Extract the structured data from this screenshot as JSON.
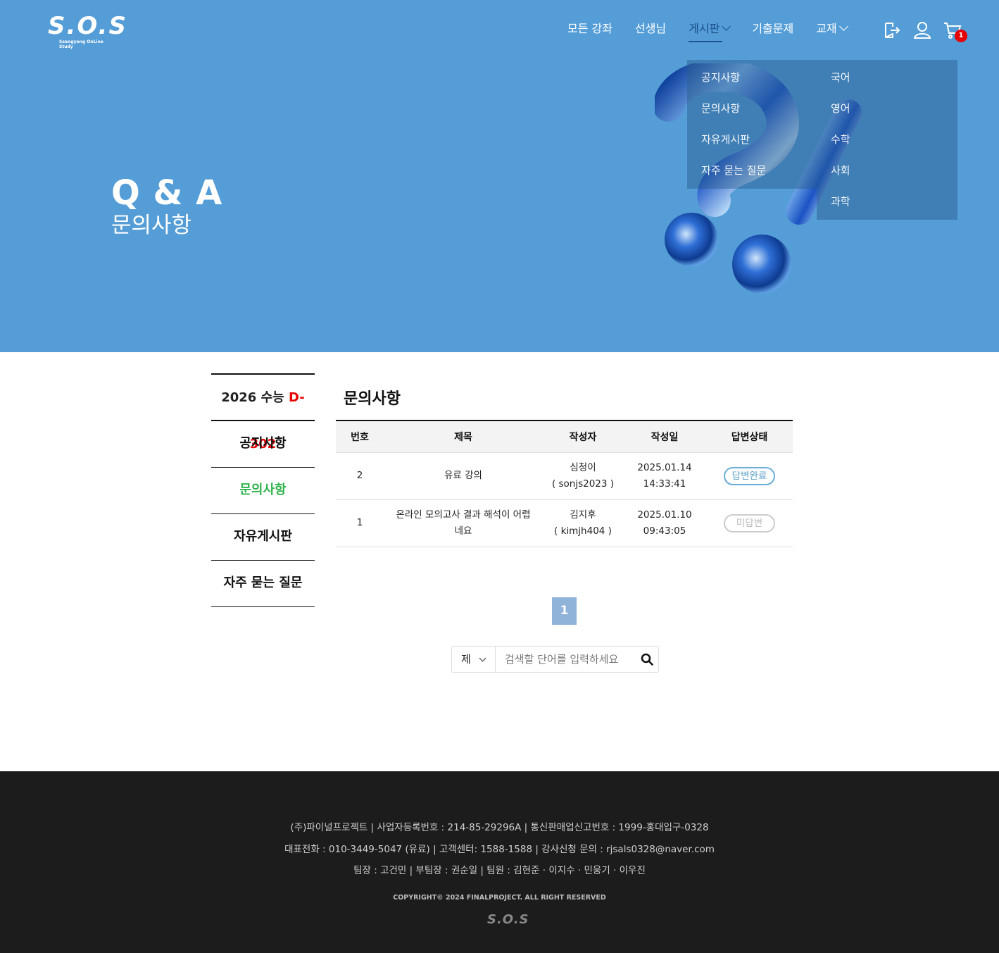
{
  "header": {
    "logo_text": "S.O.S",
    "logo_sub": "Ssangyong OnLine Study",
    "nav": [
      {
        "label": "모든 강좌"
      },
      {
        "label": "선생님"
      },
      {
        "label": "게시판"
      },
      {
        "label": "기출문제"
      },
      {
        "label": "교재"
      }
    ],
    "cart_count": "1",
    "board_menu": [
      "공지사항",
      "문의사항",
      "자유게시판",
      "자주 묻는 질문"
    ],
    "book_menu": [
      "국어",
      "영어",
      "수학",
      "사회",
      "과학"
    ]
  },
  "hero": {
    "title": "Q & A",
    "subtitle": "문의사항"
  },
  "sidebar": {
    "dday_label": "2026 수능",
    "dday_value": "D-302",
    "items": [
      "공지사항",
      "문의사항",
      "자유게시판",
      "자주 묻는 질문"
    ]
  },
  "main": {
    "title": "문의사항",
    "columns": [
      "번호",
      "제목",
      "작성자",
      "작성일",
      "답변상태"
    ],
    "rows": [
      {
        "no": "2",
        "title": "유료 강의",
        "writer": "심청이",
        "writer_id": "( sonjs2023 )",
        "date": "2025.01.14",
        "time": "14:33:41",
        "status": "답변완료"
      },
      {
        "no": "1",
        "title": "온라인 모의고사 결과 해석이 어렵네요",
        "writer": "김지후",
        "writer_id": "( kimjh404 )",
        "date": "2025.01.10",
        "time": "09:43:05",
        "status": "미답변"
      }
    ],
    "page": "1",
    "search_type": "제",
    "search_placeholder": "검색할 단어를 입력하세요"
  },
  "footer": {
    "line1": "(주)파이널프로젝트 | 사업자등록번호 : 214-85-29296A | 통신판매업신고번호 : 1999-홍대입구-0328",
    "line2": "대표전화 : 010-3449-5047 (유료) | 고객센터: 1588-1588 | 강사신청 문의 : rjsals0328@naver.com",
    "line3": "팀장 : 고건민  |  부팀장 : 권순일  |  팀원 : 김현준 · 이지수 · 민웅기 · 이우진",
    "copyright": "COPYRIGHT© 2024 FINALPROJECT. ALL RIGHT RESERVED",
    "logo_text": "S.O.S"
  }
}
